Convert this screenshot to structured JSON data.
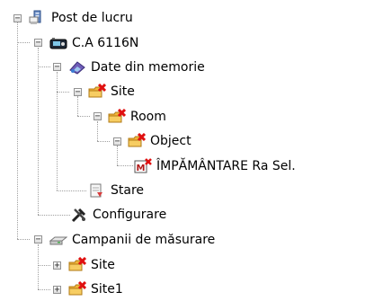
{
  "tree": {
    "root": {
      "label": "Post de lucru",
      "expanded": true
    },
    "device": {
      "label": "C.A 6116N",
      "expanded": true
    },
    "memory": {
      "label": "Date din memorie",
      "expanded": true
    },
    "site": {
      "label": "Site",
      "expanded": true
    },
    "room": {
      "label": "Room",
      "expanded": true
    },
    "object": {
      "label": "Object",
      "expanded": true
    },
    "measurement": {
      "label": "ÎMPĂMÂNTARE Ra Sel."
    },
    "state": {
      "label": "Stare"
    },
    "config": {
      "label": "Configurare"
    },
    "campaigns": {
      "label": "Campanii de măsurare",
      "expanded": true
    },
    "campaign_site": {
      "label": "Site",
      "expanded": false
    },
    "campaign_site1": {
      "label": "Site1",
      "expanded": false
    }
  },
  "expander_symbols": {
    "expanded": "−",
    "collapsed": "+"
  },
  "icons": {
    "root": "workstation-icon",
    "device": "device-icon",
    "memory": "memory-data-icon",
    "folder": "folder-with-red-x-icon",
    "measurement": "measurement-record-icon",
    "state": "state-document-icon",
    "config": "tools-icon",
    "campaigns": "disk-drive-icon"
  },
  "colors": {
    "folder": "#f2b53a",
    "red_x": "#e01010",
    "tree_line": "#a0a0a0"
  }
}
